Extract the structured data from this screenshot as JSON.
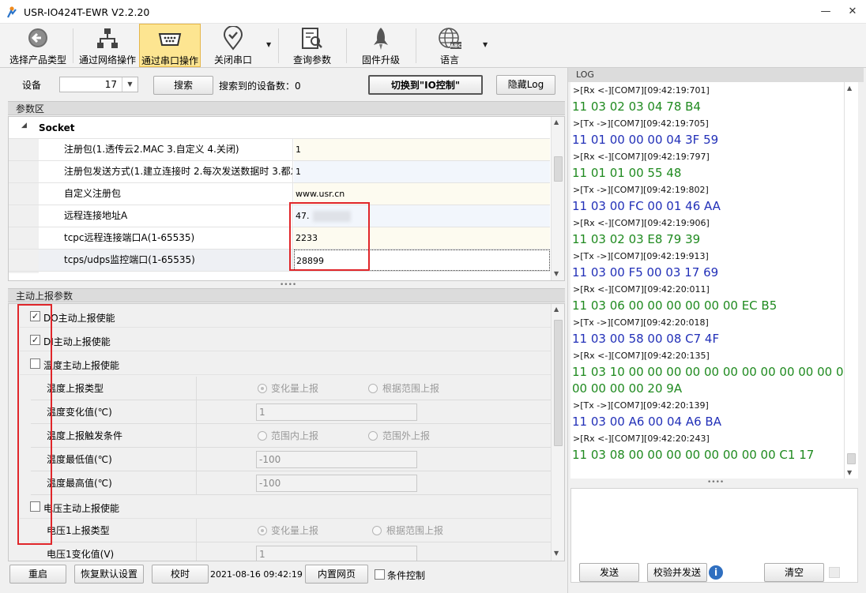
{
  "window": {
    "title": "USR-IO424T-EWR V2.2.20",
    "min": "—",
    "max": "☐",
    "close": "✕"
  },
  "toolbar": [
    {
      "label": "选择产品类型",
      "icon": "back-arrow-icon"
    },
    {
      "label": "通过网络操作",
      "icon": "network-icon"
    },
    {
      "label": "通过串口操作",
      "icon": "serial-port-icon"
    },
    {
      "label": "关闭串口",
      "icon": "location-check-icon"
    },
    {
      "label": "查询参数",
      "icon": "search-document-icon"
    },
    {
      "label": "固件升级",
      "icon": "rocket-icon"
    },
    {
      "label": "语言",
      "icon": "globe-language-icon"
    }
  ],
  "devbar": {
    "device_label": "设备",
    "device_value": "17",
    "search_btn": "搜索",
    "found_label": "搜索到的设备数：0",
    "switch_btn": "切换到\"IO控制\"",
    "hide_log_btn": "隐藏Log"
  },
  "params": {
    "section": "参数区",
    "group": "Socket",
    "rows": [
      {
        "key": "注册包(1.透传云2.MAC 3.自定义 4.关闭)",
        "value": "1"
      },
      {
        "key": "注册包发送方式(1.建立连接时 2.每次发送数据时 3.都发",
        "value": "1"
      },
      {
        "key": "自定义注册包",
        "value": "www.usr.cn"
      },
      {
        "key": "远程连接地址A",
        "value": "47."
      },
      {
        "key": "tcpc远程连接端口A(1-65535)",
        "value": "2233"
      },
      {
        "key": "tcps/udps监控端口(1-65535)",
        "value": "28899"
      }
    ]
  },
  "report": {
    "section": "主动上报参数",
    "do_enable": "DO主动上报使能",
    "di_enable": "DI主动上报使能",
    "temp_enable": "温度主动上报使能",
    "temp_type": "温度上报类型",
    "temp_change": "温度变化值(℃)",
    "temp_trigger": "温度上报触发条件",
    "temp_min": "温度最低值(℃)",
    "temp_max": "温度最高值(℃)",
    "volt_enable": "电压主动上报使能",
    "volt_type": "电压1上报类型",
    "volt_change": "电压1变化值(V)",
    "opt_change": "变化量上报",
    "opt_range": "根据范围上报",
    "opt_in": "范围内上报",
    "opt_out": "范围外上报",
    "temp_change_val": "1",
    "temp_min_val": "-100",
    "temp_max_val": "-100",
    "volt_change_val": "1"
  },
  "bottom": {
    "restart": "重启",
    "restore": "恢复默认设置",
    "timing": "校时",
    "datetime": "2021-08-16 09:42:19 1",
    "web": "内置网页",
    "cond": "条件控制"
  },
  "log": {
    "title": "LOG",
    "lines": [
      {
        "t": "h",
        "s": ">[Rx <-][COM7][09:42:19:701]"
      },
      {
        "t": "r",
        "s": "11 03 02 03 04 78 B4"
      },
      {
        "t": "h",
        "s": ">[Tx ->][COM7][09:42:19:705]"
      },
      {
        "t": "t",
        "s": "11 01 00 00 00 04 3F 59"
      },
      {
        "t": "h",
        "s": ">[Rx <-][COM7][09:42:19:797]"
      },
      {
        "t": "r",
        "s": "11 01 01 00 55 48"
      },
      {
        "t": "h",
        "s": ">[Tx ->][COM7][09:42:19:802]"
      },
      {
        "t": "t",
        "s": "11 03 00 FC 00 01 46 AA"
      },
      {
        "t": "h",
        "s": ">[Rx <-][COM7][09:42:19:906]"
      },
      {
        "t": "r",
        "s": "11 03 02 03 E8 79 39"
      },
      {
        "t": "h",
        "s": ">[Tx ->][COM7][09:42:19:913]"
      },
      {
        "t": "t",
        "s": "11 03 00 F5 00 03 17 69"
      },
      {
        "t": "h",
        "s": ">[Rx <-][COM7][09:42:20:011]"
      },
      {
        "t": "r",
        "s": "11 03 06 00 00 00 00 00 00 EC B5"
      },
      {
        "t": "h",
        "s": ">[Tx ->][COM7][09:42:20:018]"
      },
      {
        "t": "t",
        "s": "11 03 00 58 00 08 C7 4F"
      },
      {
        "t": "h",
        "s": ">[Rx <-][COM7][09:42:20:135]"
      },
      {
        "t": "r",
        "s": "11 03 10 00 00 00 00 00 00 00 00 00 00 00 00"
      },
      {
        "t": "r",
        "s": "00 00 00 00 20 9A"
      },
      {
        "t": "h",
        "s": ">[Tx ->][COM7][09:42:20:139]"
      },
      {
        "t": "t",
        "s": "11 03 00 A6 00 04 A6 BA"
      },
      {
        "t": "h",
        "s": ">[Rx <-][COM7][09:42:20:243]"
      },
      {
        "t": "r",
        "s": "11 03 08 00 00 00 00 00 00 00 00 C1 17"
      }
    ],
    "send_btn": "发送",
    "check_send_btn": "校验并发送",
    "clear_btn": "清空"
  }
}
